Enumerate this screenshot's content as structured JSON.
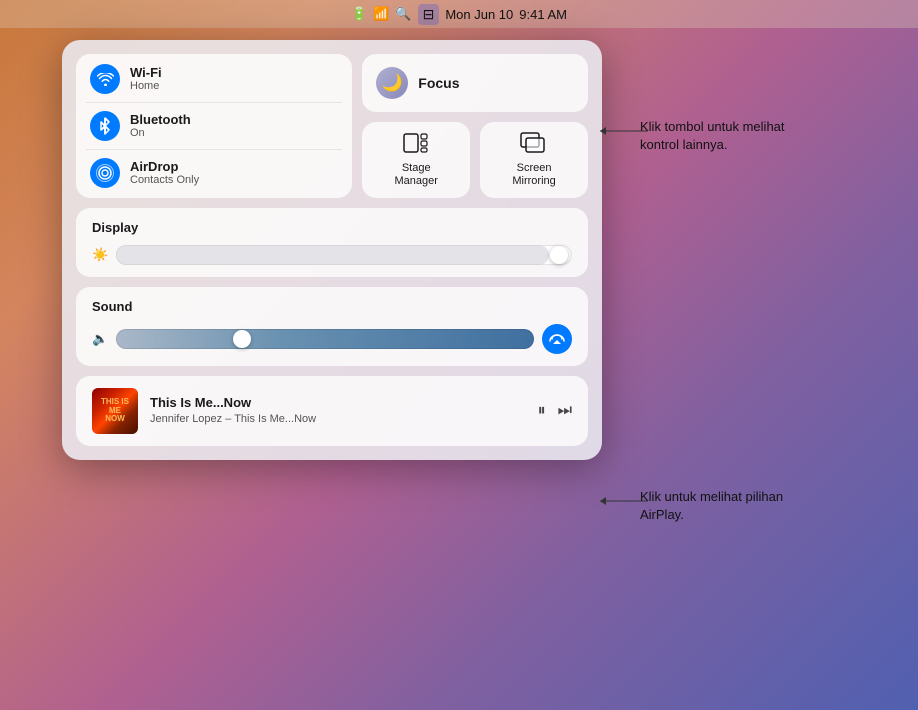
{
  "menubar": {
    "date": "Mon Jun 10",
    "time": "9:41 AM"
  },
  "connectivity": {
    "wifi_label": "Wi-Fi",
    "wifi_sub": "Home",
    "bluetooth_label": "Bluetooth",
    "bluetooth_sub": "On",
    "airdrop_label": "AirDrop",
    "airdrop_sub": "Contacts Only"
  },
  "focus": {
    "label": "Focus"
  },
  "stage_manager": {
    "label": "Stage\nManager"
  },
  "screen_mirroring": {
    "label": "Screen\nMirroring"
  },
  "display": {
    "title": "Display"
  },
  "sound": {
    "title": "Sound"
  },
  "music": {
    "title": "This Is Me...Now",
    "artist": "Jennifer Lopez – This Is Me...Now"
  },
  "annotations": {
    "top": "Klik tombol untuk melihat kontrol lainnya.",
    "bottom": "Klik untuk melihat pilihan AirPlay."
  }
}
